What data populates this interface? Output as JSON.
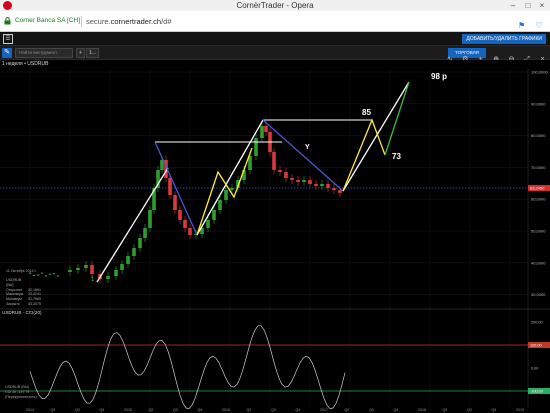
{
  "browser": {
    "window_title": "CornèrTrader - Opera",
    "site_identity": "Corner Banca SA [CH]",
    "url_host": "secure.",
    "url_domain": "cornertrader.ch",
    "url_path": "/d#"
  },
  "app": {
    "add_chart_button": "ДОБАВИТЬ/УДАЛИТЬ ГРАФИКИ"
  },
  "toolbar": {
    "search_placeholder": "Найти инструмент",
    "add_label": "+",
    "timeframe_label": "1...",
    "trade_button": "ТОРГОВЛЯ"
  },
  "chart": {
    "symbol_label": "1 неделя • USDRUB",
    "info_date": "11 Октябрь 2014 г.",
    "info_rows": [
      {
        "label": "USDRUB (Bid)",
        "value": ""
      },
      {
        "label": "Открытие",
        "value": "32,1861"
      },
      {
        "label": "Максимум",
        "value": "33,4241"
      },
      {
        "label": "Минимум",
        "value": "31,7965"
      },
      {
        "label": "Закрыть",
        "value": "33,2575"
      }
    ],
    "cci_title": "USDRUB · CCI(20)",
    "cci_info": [
      {
        "label": "USDRUB (Bid)",
        "value": ""
      },
      {
        "label": "CCI 20",
        "value": "-137,74"
      }
    ],
    "cci_foot": "(Перекупленность)",
    "annotations": {
      "target_98": "98 р",
      "level_85": "85",
      "level_73": "73",
      "label_y": "Y",
      "label_1": "1"
    },
    "price_axis": [
      "100,0000",
      "90,0000",
      "80,0000",
      "70,0000",
      "60,0000",
      "50,0000",
      "40,0000",
      "30,0000"
    ],
    "current_price": "63,2450",
    "cci_axis": [
      "200,00",
      "100,00",
      "0,00",
      "-100,00",
      "-200,00"
    ],
    "cci_marker_upper": "100,00",
    "cci_marker_lower": "-100,00",
    "time_axis": [
      "2014",
      "Q2",
      "Q3",
      "Q4",
      "2015",
      "Q2",
      "Q3",
      "Q4",
      "2016",
      "Q2",
      "Q3",
      "Q4",
      "2017",
      "Q2",
      "Q3",
      "Q4",
      "2018",
      "Q2",
      "Q3",
      "Q4",
      "2019"
    ],
    "colors": {
      "bull_candle": "#2e9e2e",
      "bear_candle": "#d63a3a",
      "impulse_line": "#ffffff",
      "correction_line": "#4b55d6",
      "yellow_line": "#ffeb3b",
      "green_line": "#38c238",
      "current_price_line": "#2f5fd0",
      "cci_upper_level": "#c0392b",
      "cci_lower_level": "#27ae60"
    }
  }
}
